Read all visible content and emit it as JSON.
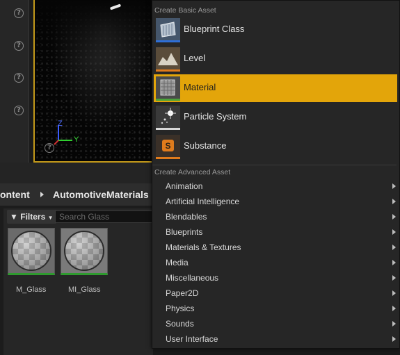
{
  "left_panel": {
    "help_icons": [
      "?",
      "?",
      "?",
      "?"
    ]
  },
  "viewport": {
    "axis": {
      "z": "Z",
      "y": "Y"
    }
  },
  "breadcrumb": {
    "items": [
      "ontent",
      "AutomotiveMaterials"
    ]
  },
  "content_browser": {
    "filters_label": "Filters",
    "search_placeholder": "Search Glass",
    "assets": [
      {
        "name": "M_Glass"
      },
      {
        "name": "MI_Glass"
      }
    ]
  },
  "context_menu": {
    "basic_header": "Create Basic Asset",
    "basic_items": [
      {
        "label": "Blueprint Class",
        "icon": "blueprint-class-icon",
        "color": "#2f6fd6"
      },
      {
        "label": "Level",
        "icon": "level-icon",
        "color": "#e07b1c"
      },
      {
        "label": "Material",
        "icon": "material-icon",
        "color": "#4ba33a",
        "highlighted": true
      },
      {
        "label": "Particle System",
        "icon": "particle-system-icon",
        "color": "#d8d8d8"
      },
      {
        "label": "Substance",
        "icon": "substance-icon",
        "color": "#e07b1c"
      }
    ],
    "advanced_header": "Create Advanced Asset",
    "advanced_items": [
      "Animation",
      "Artificial Intelligence",
      "Blendables",
      "Blueprints",
      "Materials & Textures",
      "Media",
      "Miscellaneous",
      "Paper2D",
      "Physics",
      "Sounds",
      "User Interface"
    ]
  },
  "colors": {
    "highlight": "#e3a50a",
    "viewport_border": "#c49a1a",
    "asset_material_bar": "#2e9a2e"
  }
}
